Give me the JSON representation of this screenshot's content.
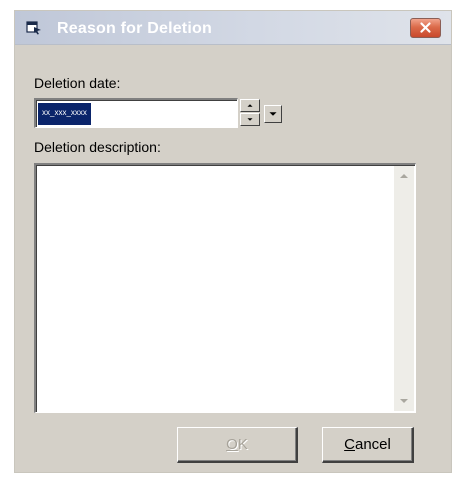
{
  "dialog": {
    "title": "Reason for Deletion",
    "accent_color": "#c9482b",
    "title_color": "#ffffff"
  },
  "deletion_date": {
    "label": "Deletion date:",
    "value": "xx_xxx_xxxx",
    "selected_color": "#0a246a"
  },
  "deletion_description": {
    "label": "Deletion description:",
    "value": ""
  },
  "buttons": {
    "ok": {
      "mnemonic": "O",
      "rest": "K",
      "enabled": false
    },
    "cancel": {
      "mnemonic": "C",
      "rest": "ancel",
      "enabled": true
    }
  },
  "icons": {
    "window": "window-app-icon",
    "close": "close-icon",
    "spin_up": "triangle-up-icon",
    "spin_down": "triangle-down-icon",
    "dropdown": "triangle-down-icon",
    "scroll_up": "scroll-up-arrow-icon",
    "scroll_down": "scroll-down-arrow-icon"
  }
}
